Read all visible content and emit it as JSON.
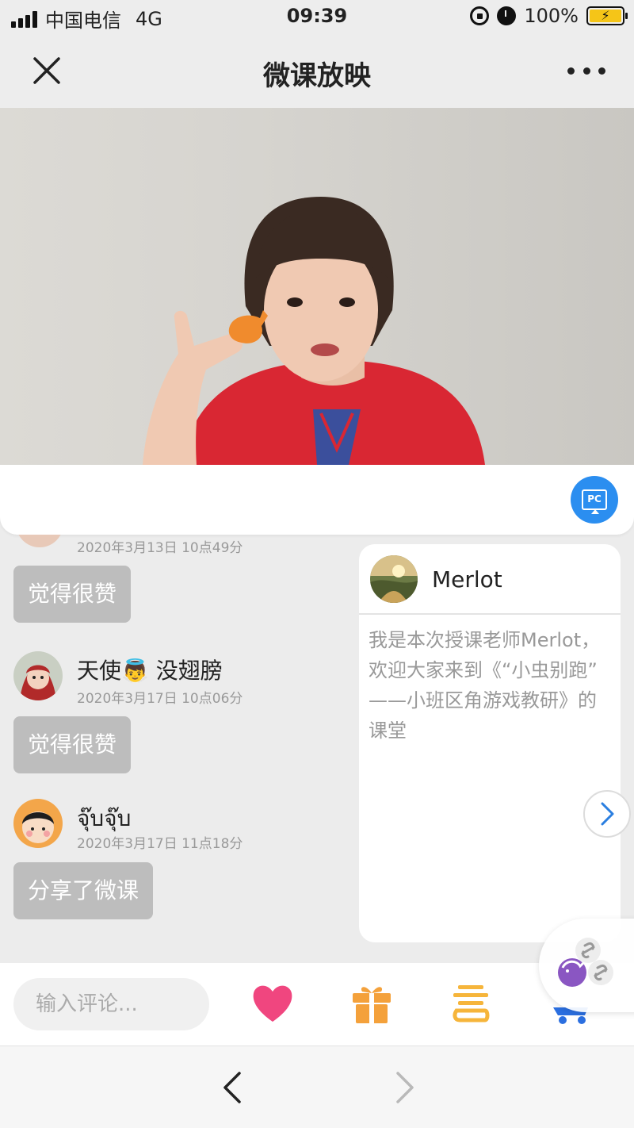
{
  "status_bar": {
    "carrier": "中国电信",
    "network": "4G",
    "time": "09:39",
    "battery": "100%"
  },
  "nav": {
    "title": "微课放映",
    "close_icon": "close-icon",
    "more_icon": "more-dots-icon"
  },
  "video": {
    "pc_label": "PC"
  },
  "comments": {
    "partial_time": "2020年3月13日 10点49分",
    "items": [
      {
        "bubble": "觉得很赞"
      },
      {
        "name": "天使👼 没翅膀",
        "time": "2020年3月17日 10点06分",
        "bubble": "觉得很赞"
      },
      {
        "name": "จุ๊บจุ๊บ",
        "time": "2020年3月17日 11点18分",
        "bubble": "分享了微课"
      }
    ]
  },
  "teacher": {
    "name": "Merlot",
    "intro": "我是本次授课老师Merlot，欢迎大家来到《“小虫别跑” ——小班区角游戏教研》的课堂"
  },
  "actionbar": {
    "comment_placeholder": "输入评论..."
  },
  "colors": {
    "heart": "#f0467f",
    "gift": "#f4a13b",
    "speech": "#f6b53b",
    "pc_button": "#2b8ef0",
    "bubble": "#bdbdbd",
    "next_arrow": "#2b7fe0"
  }
}
